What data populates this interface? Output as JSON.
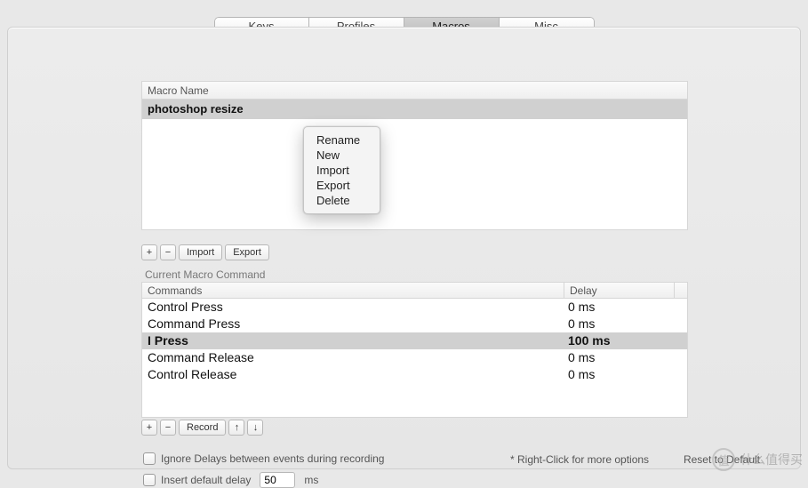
{
  "tabs": {
    "keys": "Keys",
    "profiles": "Profiles",
    "macros": "Macros",
    "misc": "Misc"
  },
  "macro": {
    "header": "Macro Name",
    "rows": {
      "r0": "photoshop resize"
    }
  },
  "tb1": {
    "add": "+",
    "rem": "−",
    "import": "Import",
    "export": "Export"
  },
  "ctx": {
    "rename": "Rename",
    "new": "New",
    "import": "Import",
    "export": "Export",
    "delete": "Delete"
  },
  "sect": "Current Macro Command",
  "cmd": {
    "h1": "Commands",
    "h2": "Delay",
    "r0c": "Control Press",
    "r0d": "0 ms",
    "r1c": "Command Press",
    "r1d": "0 ms",
    "r2c": "I Press",
    "r2d": "100 ms",
    "r3c": "Command Release",
    "r3d": "0 ms",
    "r4c": "Control Release",
    "r4d": "0 ms"
  },
  "tb2": {
    "add": "+",
    "rem": "−",
    "record": "Record",
    "up": "↑",
    "down": "↓"
  },
  "footer": {
    "ignore": "Ignore Delays between events during recording",
    "insert": "Insert default delay",
    "delay_value": "50",
    "ms": "ms",
    "hint": "* Right-Click for more options",
    "reset": "Reset to Default"
  },
  "wm": "什么值得买",
  "wm_badge": "值"
}
